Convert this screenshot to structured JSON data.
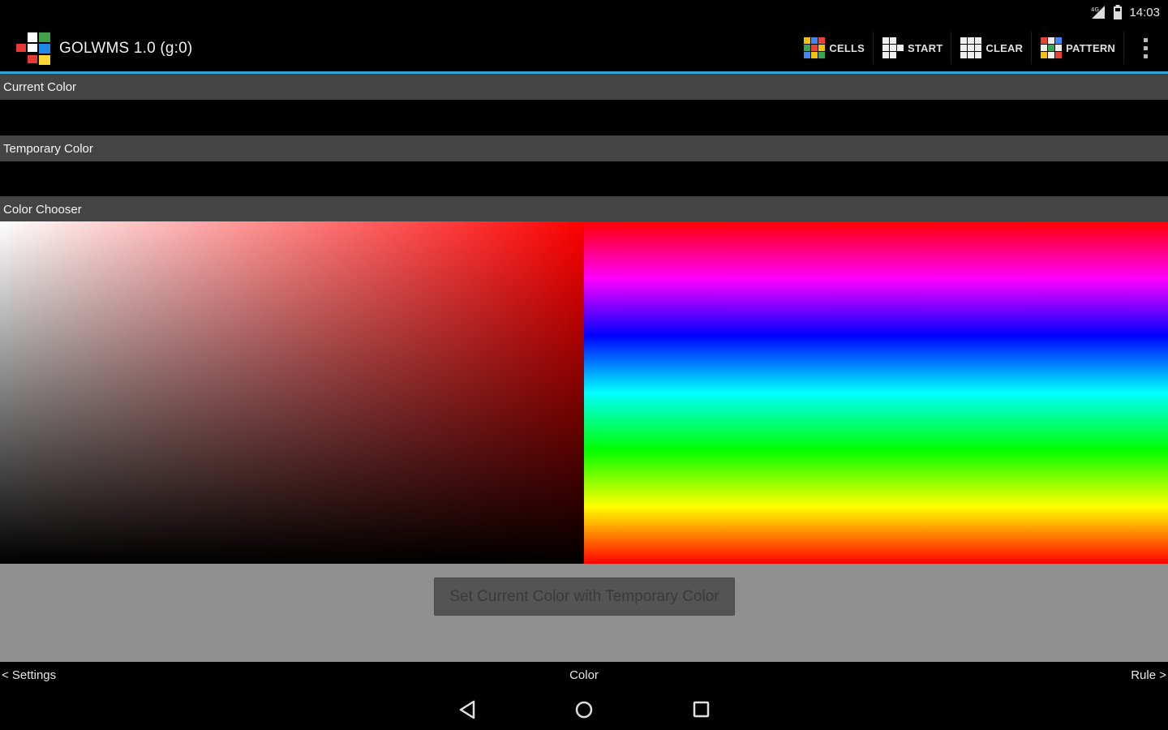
{
  "status_bar": {
    "time": "14:03"
  },
  "action_bar": {
    "title": "GOLWMS 1.0 (g:0)",
    "actions": [
      {
        "label": "CELLS",
        "icon": "cells-icon"
      },
      {
        "label": "START",
        "icon": "start-icon"
      },
      {
        "label": "CLEAR",
        "icon": "clear-icon"
      },
      {
        "label": "PATTERN",
        "icon": "pattern-icon"
      }
    ],
    "accent_color": "#33a5d6"
  },
  "sections": {
    "current_color": "Current Color",
    "temporary_color": "Temporary Color",
    "color_chooser": "Color Chooser"
  },
  "chooser": {
    "selected_hue": "#ff0000",
    "hue_stops": [
      "#ff0000",
      "#ff00ff",
      "#0000ff",
      "#00ffff",
      "#00ff00",
      "#ffff00",
      "#ff0000"
    ]
  },
  "set_button": {
    "label": "Set Current Color with Temporary Color"
  },
  "page_nav": {
    "prev": "< Settings",
    "current": "Color",
    "next": "Rule >"
  },
  "system_nav": [
    "back-icon",
    "home-icon",
    "recents-icon"
  ]
}
